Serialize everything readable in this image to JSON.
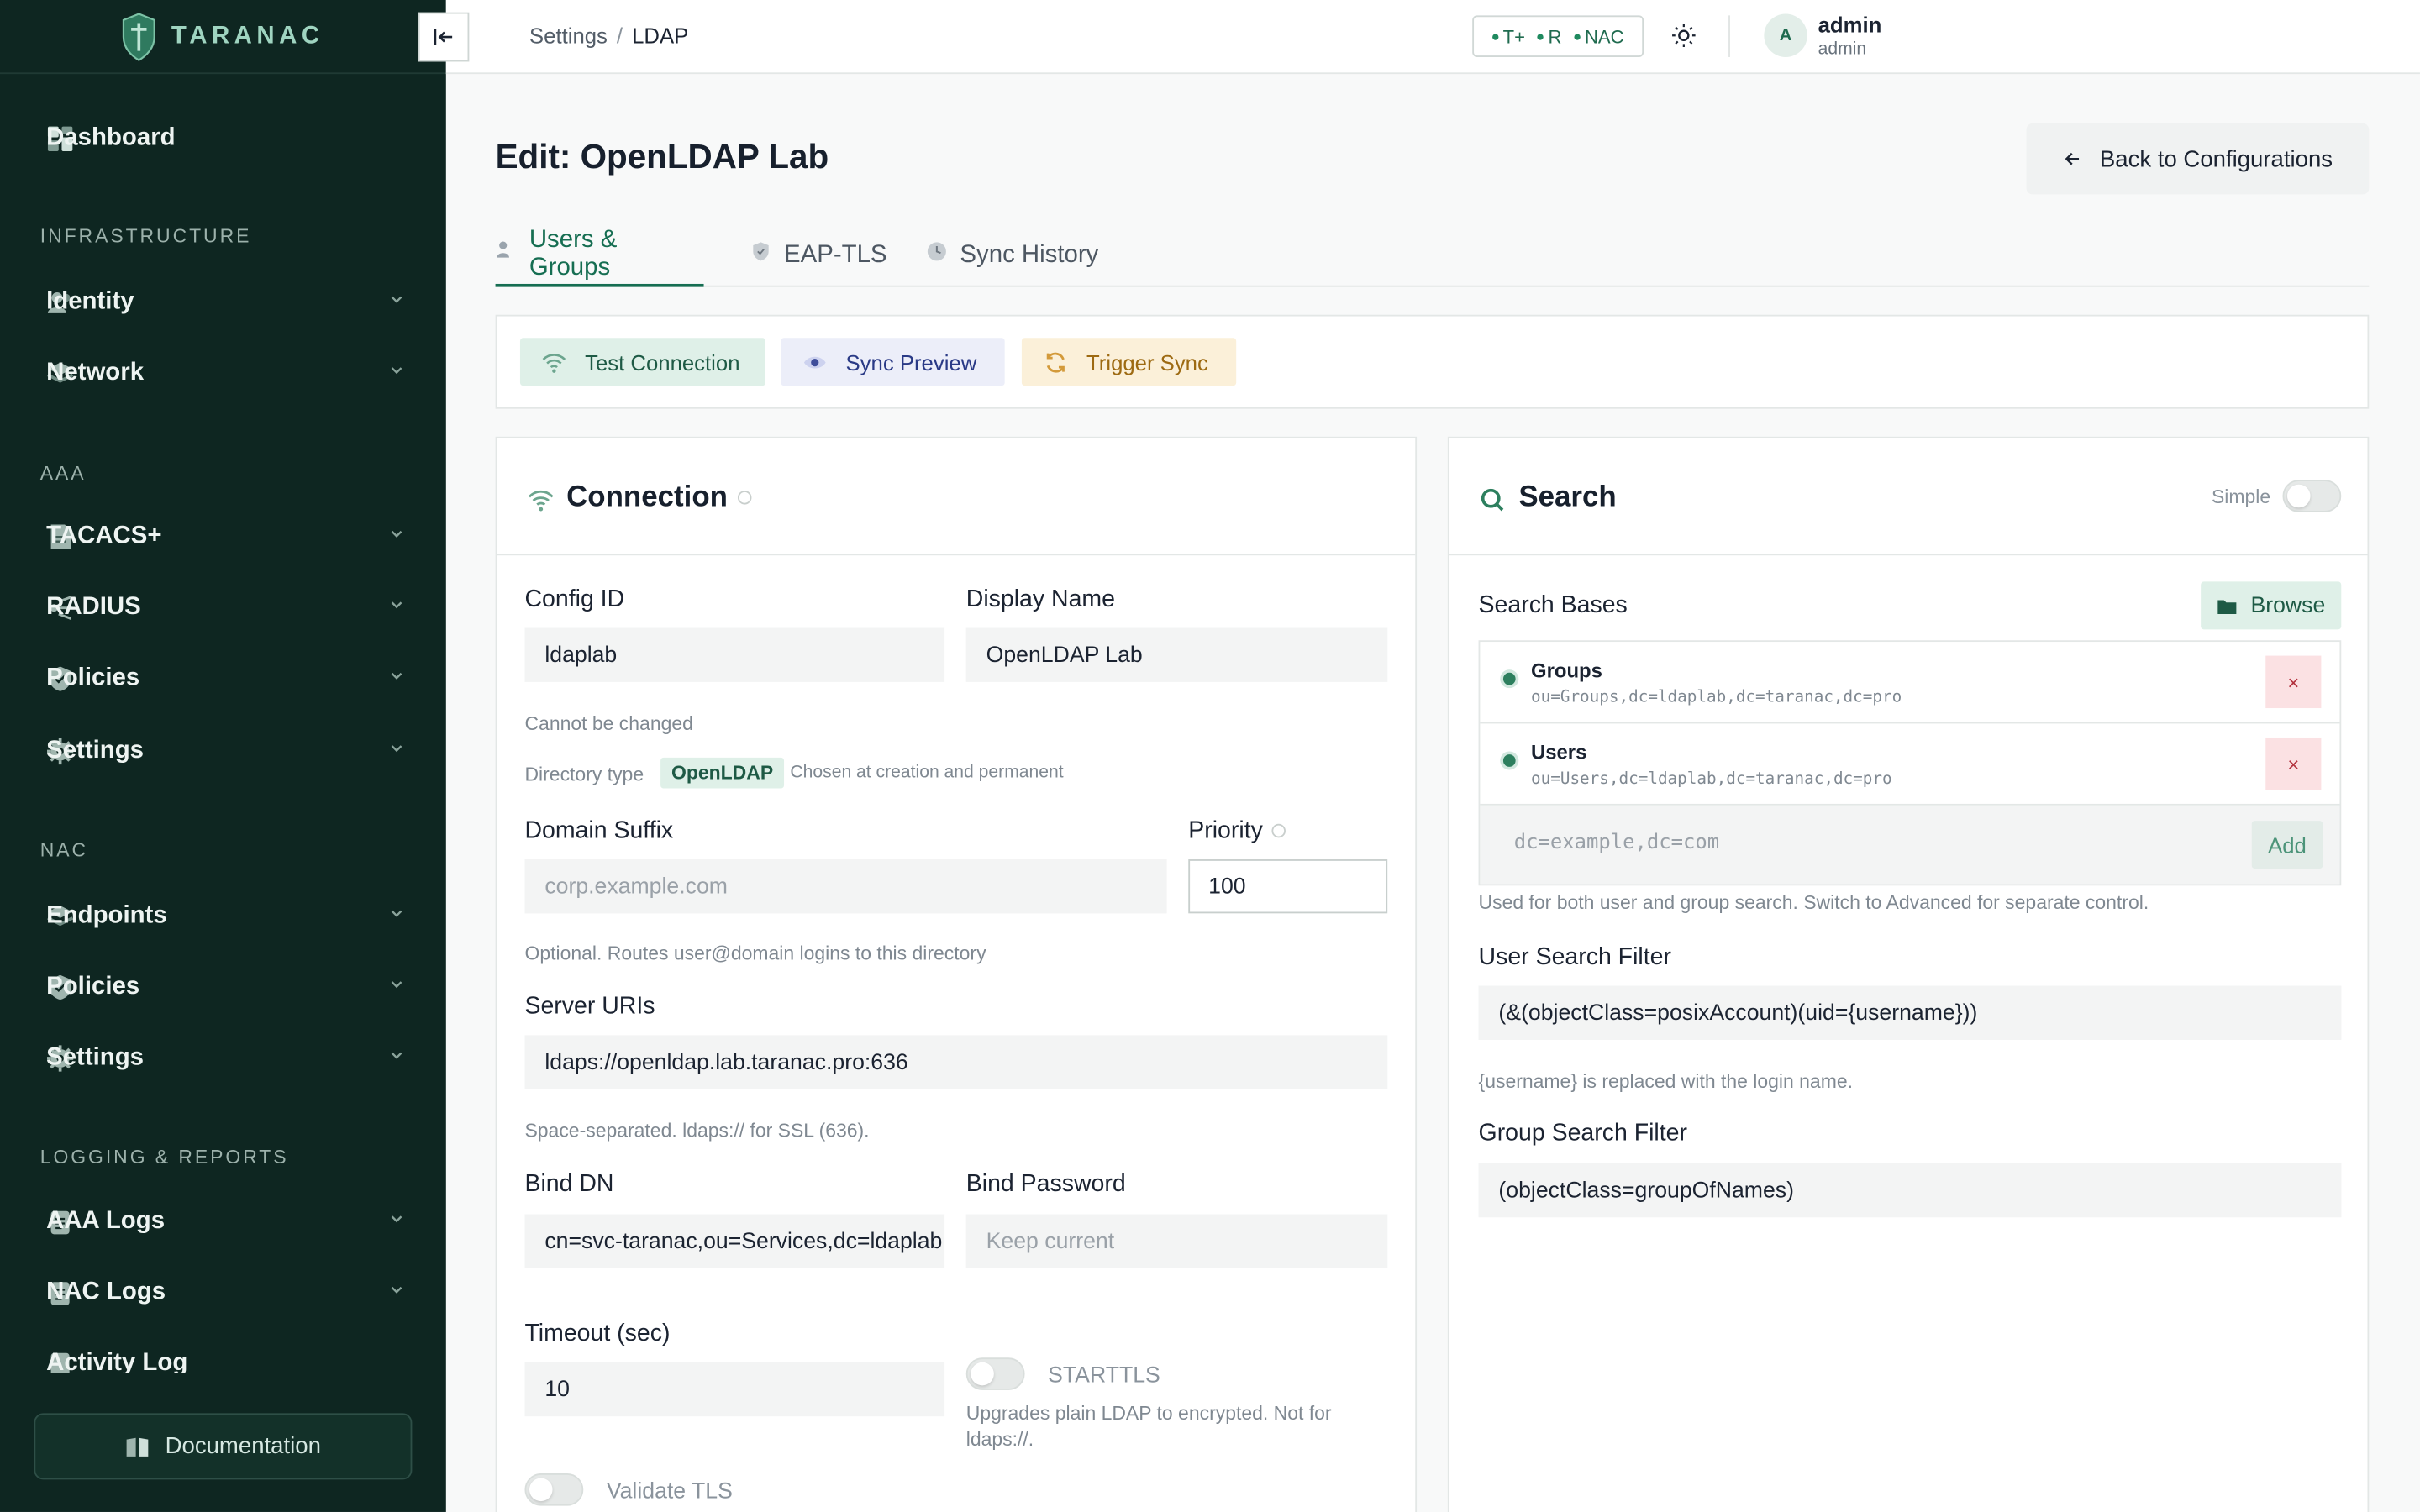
{
  "brand": {
    "name": "TARANAC"
  },
  "sidebar": {
    "dashboard": "Dashboard",
    "sections": {
      "infrastructure": "INFRASTRUCTURE",
      "aaa": "AAA",
      "nac": "NAC",
      "logging": "LOGGING & REPORTS"
    },
    "items": {
      "identity": "Identity",
      "network": "Network",
      "tacacs": "TACACS+",
      "radius": "RADIUS",
      "aaa_policies": "Policies",
      "aaa_settings": "Settings",
      "endpoints": "Endpoints",
      "nac_policies": "Policies",
      "nac_settings": "Settings",
      "aaa_logs": "AAA Logs",
      "nac_logs": "NAC Logs",
      "activity_log": "Activity Log"
    },
    "documentation": "Documentation"
  },
  "topbar": {
    "breadcrumb_parent": "Settings",
    "breadcrumb_sep": "/",
    "breadcrumb_current": "LDAP",
    "protocols": [
      "T+",
      "R",
      "NAC"
    ],
    "user_name": "admin",
    "user_role": "admin",
    "avatar_initial": "A"
  },
  "page": {
    "title": "Edit: OpenLDAP Lab",
    "back_button": "Back to Configurations",
    "tabs": [
      "Users & Groups",
      "EAP-TLS",
      "Sync History"
    ],
    "actions": {
      "test": "Test Connection",
      "preview": "Sync Preview",
      "trigger": "Trigger Sync"
    }
  },
  "connection": {
    "title": "Connection",
    "config_id_label": "Config ID",
    "config_id_value": "ldaplab",
    "display_name_label": "Display Name",
    "display_name_value": "OpenLDAP Lab",
    "config_id_hint": "Cannot be changed",
    "directory_type_label": "Directory type",
    "directory_type_value": "OpenLDAP",
    "directory_type_hint": "Chosen at creation and permanent",
    "domain_suffix_label": "Domain Suffix",
    "domain_suffix_placeholder": "corp.example.com",
    "priority_label": "Priority",
    "priority_value": "100",
    "domain_suffix_hint": "Optional. Routes user@domain logins to this directory",
    "server_uris_label": "Server URIs",
    "server_uris_value": "ldaps://openldap.lab.taranac.pro:636",
    "server_uris_hint": "Space-separated. ldaps:// for SSL (636).",
    "bind_dn_label": "Bind DN",
    "bind_dn_value": "cn=svc-taranac,ou=Services,dc=ldaplab,dc=taranac,dc=pro",
    "bind_password_label": "Bind Password",
    "bind_password_placeholder": "Keep current",
    "timeout_label": "Timeout (sec)",
    "timeout_value": "10",
    "starttls_label": "STARTTLS",
    "starttls_hint": "Upgrades plain LDAP to encrypted. Not for ldaps://.",
    "validate_tls_label": "Validate TLS"
  },
  "search": {
    "title": "Search",
    "mode_label": "Simple",
    "bases_label": "Search Bases",
    "browse_button": "Browse",
    "bases": [
      {
        "name": "Groups",
        "dn": "ou=Groups,dc=ldaplab,dc=taranac,dc=pro"
      },
      {
        "name": "Users",
        "dn": "ou=Users,dc=ldaplab,dc=taranac,dc=pro"
      }
    ],
    "remove_symbol": "×",
    "add_placeholder": "dc=example,dc=com",
    "add_button": "Add",
    "bases_hint": "Used for both user and group search. Switch to Advanced for separate control.",
    "user_filter_label": "User Search Filter",
    "user_filter_value": "(&(objectClass=posixAccount)(uid={username}))",
    "user_filter_hint": "{username} is replaced with the login name.",
    "group_filter_label": "Group Search Filter",
    "group_filter_value": "(objectClass=groupOfNames)"
  },
  "colors": {
    "sidebar_bg": "#0e2621",
    "accent": "#166e52",
    "danger": "#b3323e"
  }
}
